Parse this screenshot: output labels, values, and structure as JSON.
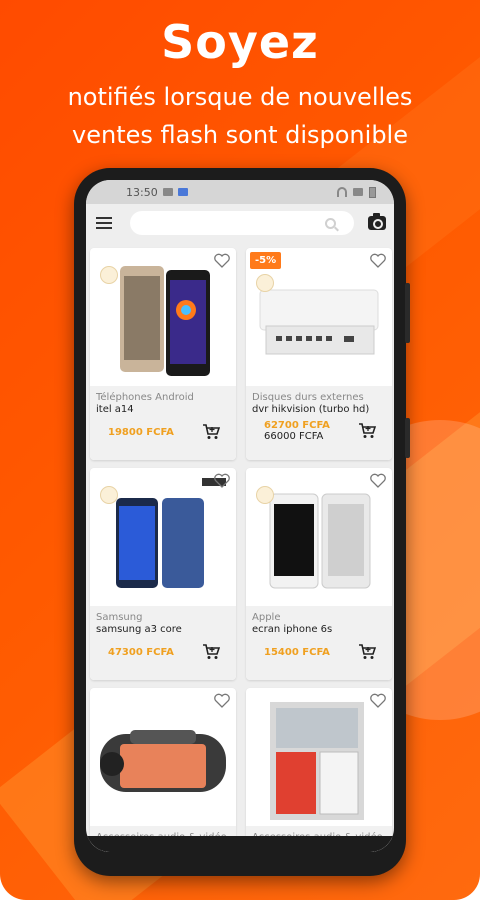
{
  "promo": {
    "title": "Soyez",
    "line1": "notifiés lorsque de nouvelles",
    "line2": "ventes flash sont disponible"
  },
  "statusbar": {
    "time": "13:50"
  },
  "colors": {
    "brand": "#ff5500",
    "price": "#f0a020",
    "discount": "#ff7a1a"
  },
  "products": [
    {
      "category": "Téléphones Android",
      "name": "itel a14",
      "price": "19800 FCFA",
      "old_price": "",
      "discount": "",
      "image": "phone-gold"
    },
    {
      "category": "Disques durs externes",
      "name": "dvr hikvision (turbo hd)",
      "price": "62700 FCFA",
      "old_price": "66000 FCFA",
      "discount": "-5%",
      "image": "dvr"
    },
    {
      "category": "Samsung",
      "name": "samsung a3 core",
      "price": "47300 FCFA",
      "old_price": "",
      "discount": "",
      "image": "phone-blue"
    },
    {
      "category": "Apple",
      "name": "ecran iphone 6s",
      "price": "15400 FCFA",
      "old_price": "",
      "discount": "",
      "image": "screen"
    },
    {
      "category": "Accessoires audio & vidéo",
      "name": "",
      "price": "",
      "old_price": "",
      "discount": "",
      "image": "speaker"
    },
    {
      "category": "Accessoires audio & vidéo",
      "name": "",
      "price": "",
      "old_price": "",
      "discount": "",
      "image": "poster"
    }
  ],
  "icons": [
    "menu-icon",
    "search-icon",
    "camera-icon",
    "heart-icon",
    "cart-icon"
  ]
}
